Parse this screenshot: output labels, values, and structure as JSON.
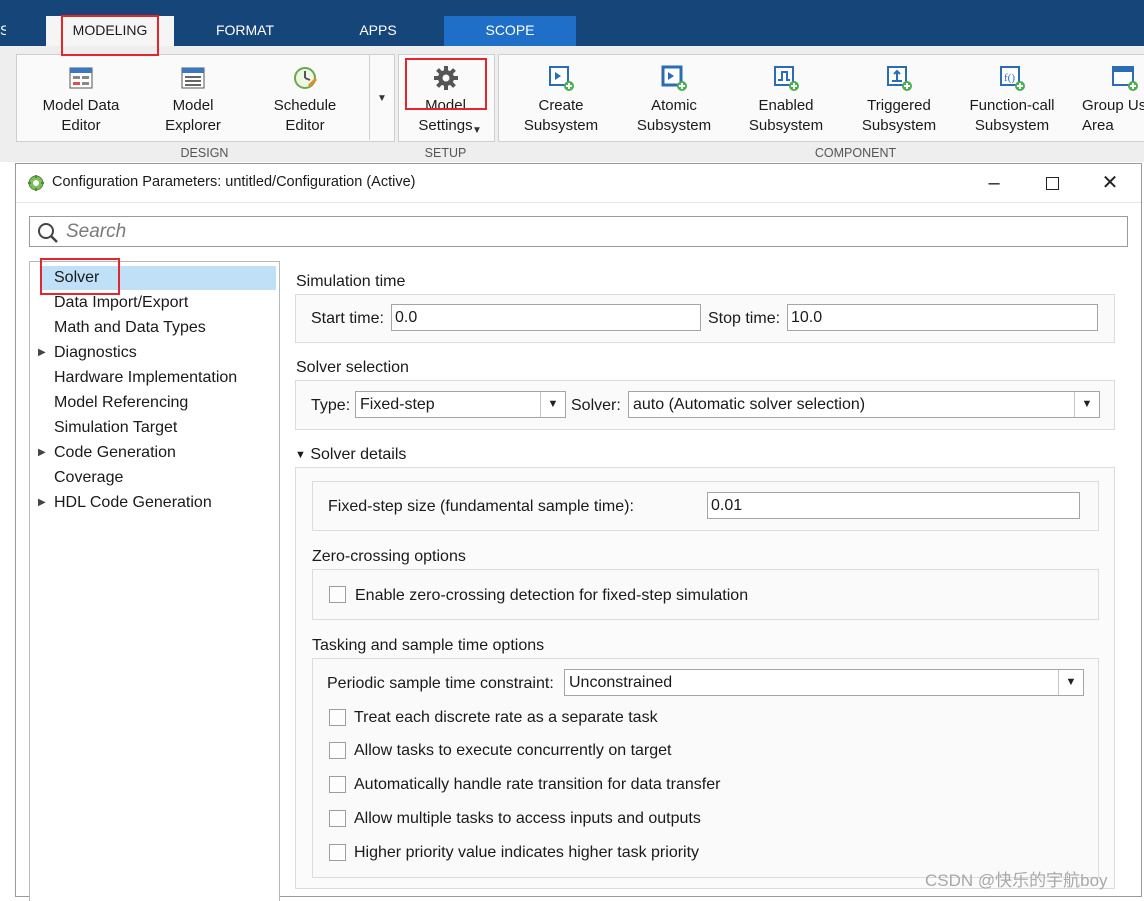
{
  "tabs": {
    "left_fragment": "S",
    "modeling": "MODELING",
    "format": "FORMAT",
    "apps": "APPS",
    "scope": "SCOPE"
  },
  "ribbon": {
    "design": {
      "label": "DESIGN",
      "model_data_editor": "Model Data\nEditor",
      "model_explorer": "Model\nExplorer",
      "schedule_editor": "Schedule\nEditor"
    },
    "setup": {
      "label": "SETUP",
      "model_settings": "Model\nSettings"
    },
    "component": {
      "label": "COMPONENT",
      "create_subsystem": "Create\nSubsystem",
      "atomic_subsystem": "Atomic\nSubsystem",
      "enabled_subsystem": "Enabled\nSubsystem",
      "triggered_subsystem": "Triggered\nSubsystem",
      "function_call_subsystem": "Function-call\nSubsystem",
      "group_using_area": "Group Us\nArea"
    }
  },
  "dialog": {
    "title": "Configuration Parameters: untitled/Configuration (Active)",
    "search_placeholder": "Search",
    "tree": [
      {
        "label": "Solver",
        "expandable": false,
        "selected": true
      },
      {
        "label": "Data Import/Export",
        "expandable": false
      },
      {
        "label": "Math and Data Types",
        "expandable": false
      },
      {
        "label": "Diagnostics",
        "expandable": true
      },
      {
        "label": "Hardware Implementation",
        "expandable": false
      },
      {
        "label": "Model Referencing",
        "expandable": false
      },
      {
        "label": "Simulation Target",
        "expandable": false
      },
      {
        "label": "Code Generation",
        "expandable": true
      },
      {
        "label": "Coverage",
        "expandable": false
      },
      {
        "label": "HDL Code Generation",
        "expandable": true
      }
    ],
    "simulation_time": {
      "heading": "Simulation time",
      "start_label": "Start time:",
      "start_value": "0.0",
      "stop_label": "Stop time:",
      "stop_value": "10.0"
    },
    "solver_selection": {
      "heading": "Solver selection",
      "type_label": "Type:",
      "type_value": "Fixed-step",
      "solver_label": "Solver:",
      "solver_value": "auto (Automatic solver selection)"
    },
    "solver_details": {
      "heading": "Solver details",
      "fixed_step_label": "Fixed-step size (fundamental sample time):",
      "fixed_step_value": "0.01",
      "zero_crossing_heading": "Zero-crossing options",
      "zero_crossing_checkbox": "Enable zero-crossing detection for fixed-step simulation",
      "tasking_heading": "Tasking and sample time options",
      "periodic_label": "Periodic sample time constraint:",
      "periodic_value": "Unconstrained",
      "checkboxes": [
        "Treat each discrete rate as a separate task",
        "Allow tasks to execute concurrently on target",
        "Automatically handle rate transition for data transfer",
        "Allow multiple tasks to access inputs and outputs",
        "Higher priority value indicates higher task priority"
      ]
    }
  },
  "watermark": "CSDN @快乐的宇航boy",
  "colors": {
    "tabbar": "#16457a",
    "scope_tab": "#1f6fc8",
    "highlight": "#e3262c",
    "selection": "#bfe0f7"
  }
}
